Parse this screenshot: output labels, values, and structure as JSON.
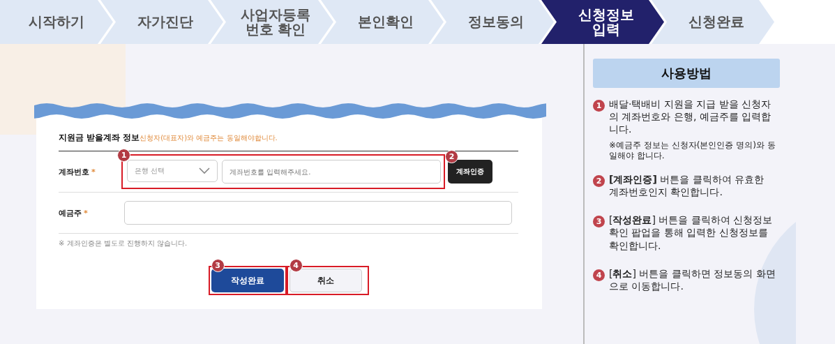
{
  "steps": [
    {
      "label": "시작하기",
      "selected": false
    },
    {
      "label": "자가진단",
      "selected": false
    },
    {
      "label": "사업자등록\n번호 확인",
      "selected": false
    },
    {
      "label": "본인확인",
      "selected": false
    },
    {
      "label": "정보동의",
      "selected": false
    },
    {
      "label": "신청정보\n입력",
      "selected": true
    },
    {
      "label": "신청완료",
      "selected": false
    }
  ],
  "form": {
    "title": "지원금 받을계좌 정보",
    "subtitle": "신청자(대표자)와 예금주는 동일해야합니다.",
    "account": {
      "label": "계좌번호",
      "required_mark": "*",
      "bank_placeholder": "은행 선택",
      "number_placeholder": "계좌번호를 입력해주세요.",
      "verify_button": "계좌인증",
      "callout_fields": "1",
      "callout_verify": "2"
    },
    "holder": {
      "label": "예금주",
      "required_mark": "*"
    },
    "note": "※ 계좌인증은 별도로 진행하지 않습니다.",
    "buttons": [
      {
        "label": "작성완료",
        "kind": "primary",
        "callout": "3"
      },
      {
        "label": "취소",
        "kind": "secondary",
        "callout": "4"
      }
    ]
  },
  "guide": {
    "title": "사용방법",
    "items": [
      {
        "number": "1",
        "text": "배달·택배비 지원을 지급 받을 신청자의 계좌번호와 은행, 예금주를 입력합니다.",
        "note": "※예금주 정보는 신청자(본인인증 명의)와 동일해야 합니다."
      },
      {
        "number": "2",
        "text": "**[계좌인증]** 버튼을 클릭하여 유효한 계좌번호인지 확인합니다."
      },
      {
        "number": "3",
        "text": "[**작성완료**] 버튼을 클릭하여 신청정보 확인 팝업을 통해 입력한 신청정보를 확인합니다."
      },
      {
        "number": "4",
        "text": "[**취소**] 버튼을 클릭하면 정보동의 화면으로 이동합니다."
      }
    ]
  }
}
